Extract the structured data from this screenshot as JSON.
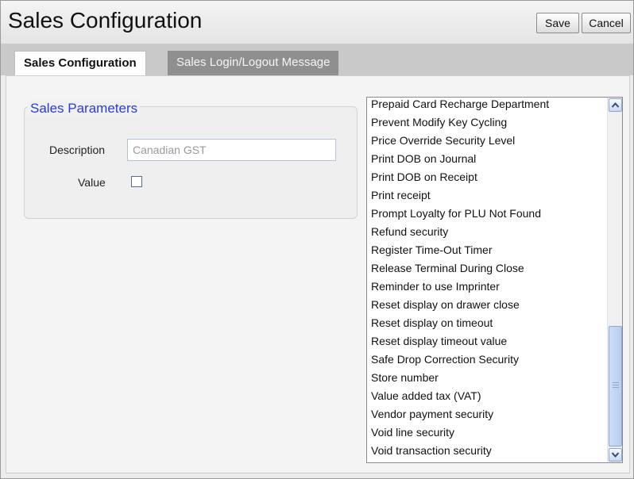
{
  "header": {
    "title": "Sales Configuration",
    "save_label": "Save",
    "cancel_label": "Cancel"
  },
  "tabs": [
    {
      "label": "Sales Configuration",
      "active": true
    },
    {
      "label": "Sales Login/Logout Message",
      "active": false
    }
  ],
  "sales_parameters": {
    "legend": "Sales Parameters",
    "description_label": "Description",
    "description_value": "Canadian GST",
    "value_label": "Value",
    "value_checked": false
  },
  "parameter_list": {
    "items": [
      "Prepaid Card Recharge Department",
      "Prevent Modify Key Cycling",
      "Price Override Security Level",
      "Print DOB on Journal",
      "Print DOB on Receipt",
      "Print receipt",
      "Prompt Loyalty for PLU Not Found",
      "Refund security",
      "Register Time-Out Timer",
      "Release Terminal During Close",
      "Reminder to use Imprinter",
      "Reset display on drawer close",
      "Reset display on timeout",
      "Reset display timeout value",
      "Safe Drop Correction Security",
      "Store number",
      "Value added tax (VAT)",
      "Vendor payment security",
      "Void line security",
      "Void transaction security"
    ]
  },
  "colors": {
    "legend": "#2a3bd6",
    "active_tab_bg": "#ffffff",
    "inactive_tab_bg": "#8f8f8f"
  },
  "icons": {
    "scroll_up": "chevron-up-icon",
    "scroll_down": "chevron-down-icon"
  }
}
